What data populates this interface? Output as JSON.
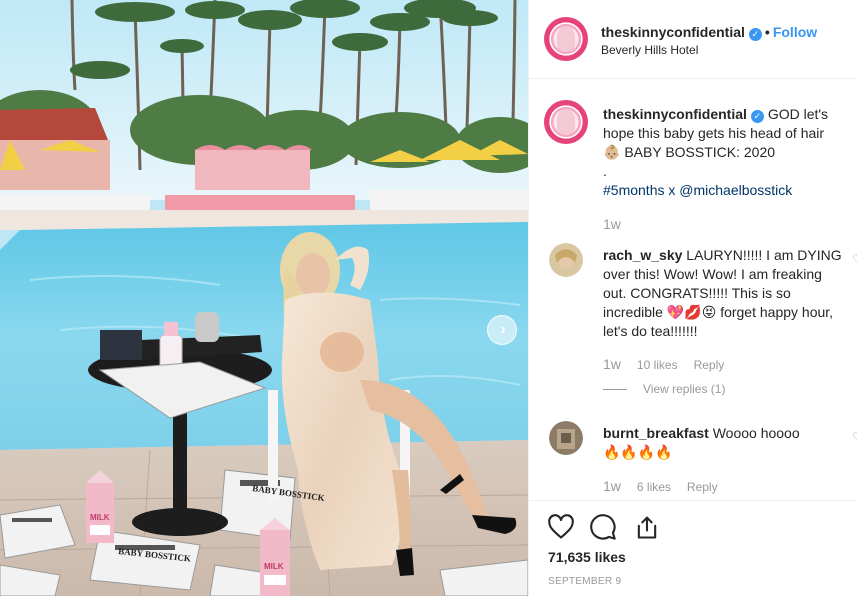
{
  "post": {
    "username": "theskinnyconfidential",
    "follow_label": "Follow",
    "location": "Beverly Hills Hotel",
    "separator": "•"
  },
  "caption": {
    "username": "theskinnyconfidential",
    "text_1": "GOD let's hope this baby gets his head of hair",
    "emoji": "👶🏼",
    "text_2": "BABY BOSSTICK: 2020",
    "dot": ".",
    "hashtag": "#5months",
    "joiner": " x ",
    "mention": "@michaelbosstick",
    "time": "1w"
  },
  "comments": [
    {
      "username": "rach_w_sky",
      "text": "LAURYN!!!!! I am DYING over this! Wow! Wow! I am freaking out. CONGRATS!!!!! This is so incredible",
      "emoji_1": "💖💋😝",
      "text_after": "forget happy hour, let's do tea!!!!!!!",
      "time": "1w",
      "likes": "10 likes",
      "reply": "Reply",
      "view_replies": "View replies (1)"
    },
    {
      "username": "burnt_breakfast",
      "text": "Woooo hoooo",
      "emoji": "🔥🔥🔥🔥",
      "time": "1w",
      "likes": "6 likes",
      "reply": "Reply"
    }
  ],
  "footer": {
    "likes": "71,635 likes",
    "date": "SEPTEMBER 9"
  },
  "photo": {
    "milk_label": "MILK",
    "newspaper_headline": "BABY BOSSTICK",
    "arrow": "›"
  },
  "icons": {
    "like": "heart-icon",
    "comment": "comment-bubble-icon",
    "share": "share-icon",
    "next": "chevron-right-icon"
  },
  "colors": {
    "link_blue": "#3897f0",
    "hashtag": "#003569",
    "muted": "#999999"
  }
}
